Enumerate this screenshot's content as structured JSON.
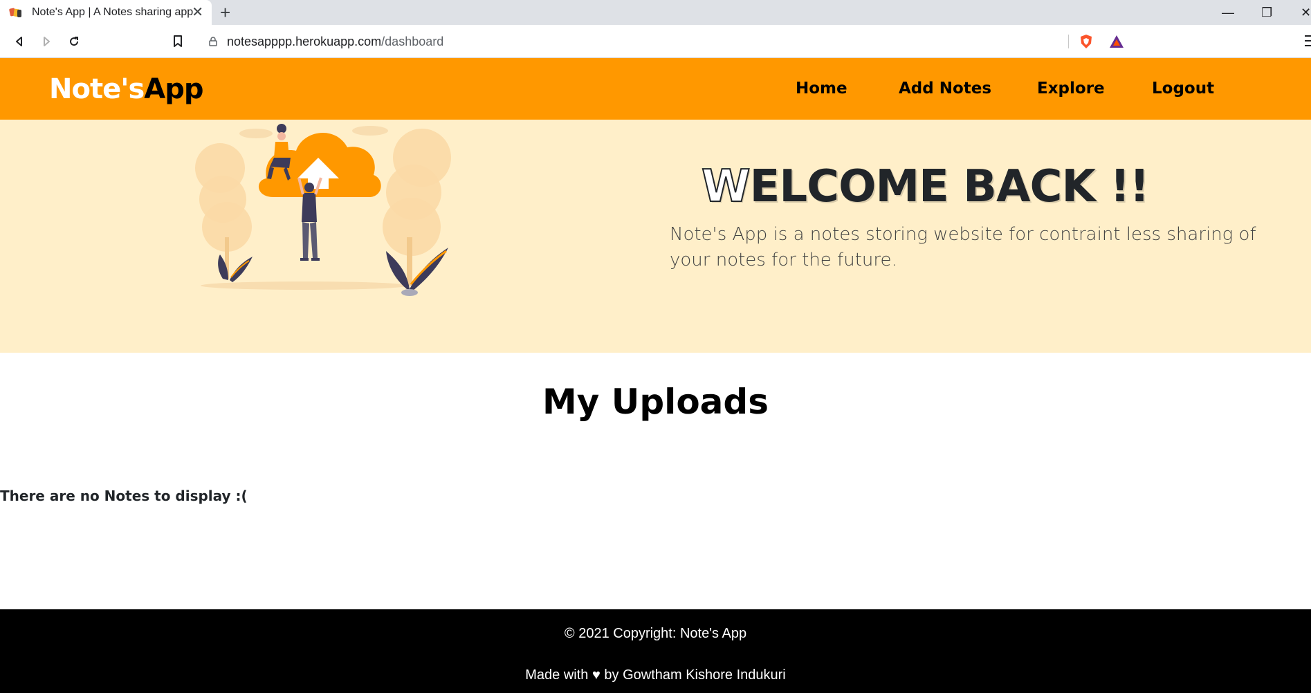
{
  "browser": {
    "tab_title": "Note's App | A Notes sharing app",
    "tab_close": "✕",
    "new_tab": "+",
    "url_host": "notesapppp.herokuapp.com",
    "url_path": "/dashboard",
    "window_minimize": "—",
    "window_restore": "❐",
    "window_close": "✕"
  },
  "navbar": {
    "brand_part1": "Note's",
    "brand_part2": "App",
    "links": [
      "Home",
      "Add Notes",
      "Explore",
      "Logout"
    ]
  },
  "hero": {
    "title_first": "W",
    "title_rest": "ELCOME BACK !!",
    "subtitle": "Note's App is a notes storing website for contraint less sharing of your notes for the future."
  },
  "main": {
    "section_title": "My Uploads",
    "empty_message": "There are no Notes to display :("
  },
  "footer": {
    "copyright": "© 2021 Copyright: Note's App",
    "made_with": "Made with ♥ by Gowtham Kishore Indukuri"
  },
  "colors": {
    "navbar": "#ff9800",
    "hero_bg": "#ffefc9",
    "footer": "#000000"
  }
}
